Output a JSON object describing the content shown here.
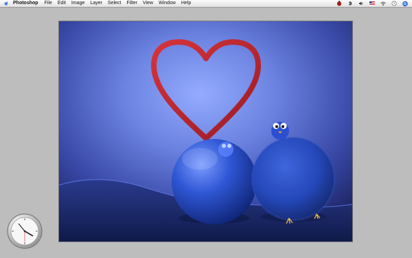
{
  "menubar": {
    "app_name": "Photoshop",
    "items": [
      {
        "label": "File"
      },
      {
        "label": "Edit"
      },
      {
        "label": "Image"
      },
      {
        "label": "Layer"
      },
      {
        "label": "Select"
      },
      {
        "label": "Filter"
      },
      {
        "label": "View"
      },
      {
        "label": "Window"
      },
      {
        "label": "Help"
      }
    ],
    "status_icons": [
      "ladybug-icon",
      "bluetooth-icon",
      "volume-icon",
      "flag-icon",
      "wifi-icon",
      "clock-icon",
      "spotlight-icon"
    ]
  },
  "canvas": {
    "artwork": "heart and two blue birds wallpaper"
  },
  "clock_widget": {
    "icon": "analog-clock-icon"
  },
  "colors": {
    "desktop": "#bdbdbd",
    "heart": "#c0242c",
    "sky_center": "#8fa6ff",
    "sky_edge": "#1c2460"
  }
}
